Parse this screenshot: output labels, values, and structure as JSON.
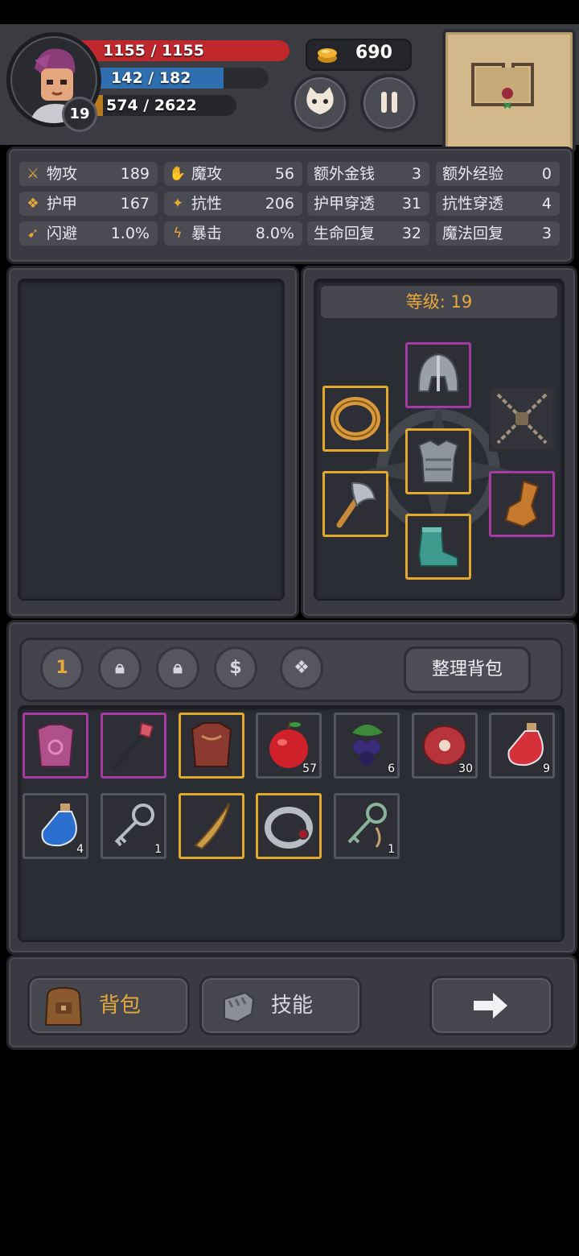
{
  "player": {
    "hp_text": "1155 / 1155",
    "mp_text": "142 / 182",
    "xp_text": "574 / 2622",
    "level": "19",
    "hp_fraction": 1.0,
    "mp_fraction": 0.78,
    "xp_fraction": 0.22
  },
  "gold": "690",
  "stats": [
    {
      "label": "物攻",
      "value": "189",
      "icon": "sword-icon"
    },
    {
      "label": "魔攻",
      "value": "56",
      "icon": "magic-hand-icon"
    },
    {
      "label": "额外金钱",
      "value": "3"
    },
    {
      "label": "额外经验",
      "value": "0"
    },
    {
      "label": "护甲",
      "value": "167",
      "icon": "paw-shield-icon"
    },
    {
      "label": "抗性",
      "value": "206",
      "icon": "resist-icon"
    },
    {
      "label": "护甲穿透",
      "value": "31"
    },
    {
      "label": "抗性穿透",
      "value": "4"
    },
    {
      "label": "闪避",
      "value": "1.0%",
      "icon": "running-icon"
    },
    {
      "label": "暴击",
      "value": "8.0%",
      "icon": "lightning-icon"
    },
    {
      "label": "生命回复",
      "value": "32"
    },
    {
      "label": "魔法回复",
      "value": "3"
    }
  ],
  "equipment": {
    "level_label": "等级: 19",
    "slots": [
      {
        "name": "helmet",
        "rarity": "purple"
      },
      {
        "name": "ring",
        "rarity": "gold"
      },
      {
        "name": "chain-slot",
        "rarity": "none"
      },
      {
        "name": "chest-armor",
        "rarity": "gold"
      },
      {
        "name": "axe",
        "rarity": "gold"
      },
      {
        "name": "gauntlet",
        "rarity": "purple"
      },
      {
        "name": "boots",
        "rarity": "gold"
      }
    ]
  },
  "inventory": {
    "tabs": [
      {
        "label": "1",
        "icon": "page-one"
      },
      {
        "label": "",
        "icon": "lock-icon"
      },
      {
        "label": "",
        "icon": "lock-icon"
      },
      {
        "label": "$",
        "icon": "dollar-icon"
      },
      {
        "label": "",
        "icon": "paw-icon"
      }
    ],
    "sort_label": "整理背包",
    "items": [
      {
        "name": "pink-vest",
        "rarity": "purple",
        "count": ""
      },
      {
        "name": "staff",
        "rarity": "purple",
        "count": ""
      },
      {
        "name": "leather-armor",
        "rarity": "gold",
        "count": ""
      },
      {
        "name": "apple",
        "rarity": "gray",
        "count": "57"
      },
      {
        "name": "berries",
        "rarity": "gray",
        "count": "6"
      },
      {
        "name": "meat",
        "rarity": "gray",
        "count": "30"
      },
      {
        "name": "red-potion",
        "rarity": "gray",
        "count": "9"
      },
      {
        "name": "blue-potion",
        "rarity": "gray",
        "count": "4"
      },
      {
        "name": "silver-key",
        "rarity": "gray",
        "count": "1"
      },
      {
        "name": "curved-dagger",
        "rarity": "gold",
        "count": ""
      },
      {
        "name": "silver-ring",
        "rarity": "gold",
        "count": ""
      },
      {
        "name": "green-key",
        "rarity": "gray",
        "count": "1"
      }
    ]
  },
  "nav": {
    "bag_label": "背包",
    "skills_label": "技能"
  },
  "colors": {
    "hp": "#c0282d",
    "mp": "#2f6fb0",
    "xp": "#b87a1f",
    "gold_accent": "#e8a93a",
    "purple_rarity": "#a63aa3",
    "gold_rarity": "#e2aa2b"
  }
}
